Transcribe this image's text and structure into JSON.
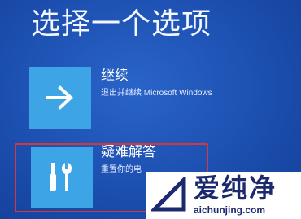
{
  "title": "选择一个选项",
  "options": [
    {
      "label": "继续",
      "description": "退出并继续 Microsoft Windows",
      "icon": "arrow-right-icon"
    },
    {
      "label": "疑难解答",
      "description": "重置你的电",
      "icon": "tools-icon"
    }
  ],
  "watermark": {
    "text": "爱纯净",
    "url": "aichunjing.com"
  },
  "colors": {
    "background": "#1c4fb0",
    "tile": "#3da4e6",
    "highlight": "#d23a3a",
    "watermark_text": "#1b2a6e"
  }
}
